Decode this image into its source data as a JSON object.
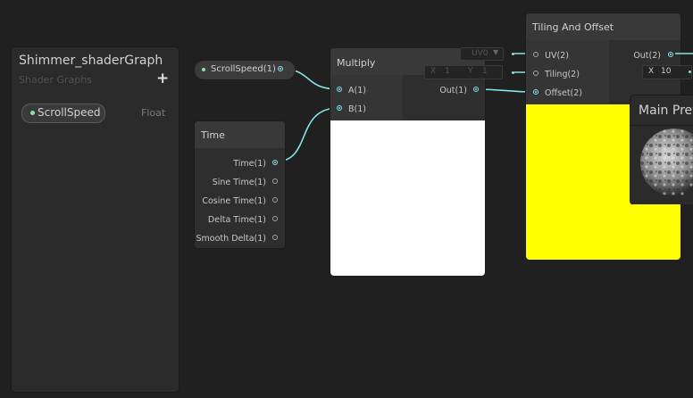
{
  "blackboard": {
    "title": "Shimmer_shaderGraph",
    "subtitle": "Shader Graphs",
    "add_symbol": "+",
    "properties": [
      {
        "name": "ScrollSpeed",
        "type": "Float"
      }
    ]
  },
  "property_node": {
    "label": "ScrollSpeed(1)"
  },
  "time_node": {
    "title": "Time",
    "outputs": [
      "Time(1)",
      "Sine Time(1)",
      "Cosine Time(1)",
      "Delta Time(1)",
      "Smooth Delta(1)"
    ]
  },
  "multiply_node": {
    "title": "Multiply",
    "inputs": [
      "A(1)",
      "B(1)"
    ],
    "output": "Out(1)",
    "preview_color": "#ffffff"
  },
  "tiling_node": {
    "title": "Tiling And Offset",
    "inputs": [
      "UV(2)",
      "Tiling(2)",
      "Offset(2)"
    ],
    "output": "Out(2)",
    "uv_dropdown": "UV0",
    "tiling_x_label": "X",
    "tiling_x_value": "1",
    "tiling_y_label": "Y",
    "tiling_y_value": "1",
    "preview_color": "#ffff00"
  },
  "downstream_input": {
    "label": "X",
    "value": "10"
  },
  "main_preview": {
    "title": "Main Preview"
  },
  "colors": {
    "wire": "#84e4e7",
    "property_dot": "#8ce3a2",
    "canvas": "#202020"
  }
}
